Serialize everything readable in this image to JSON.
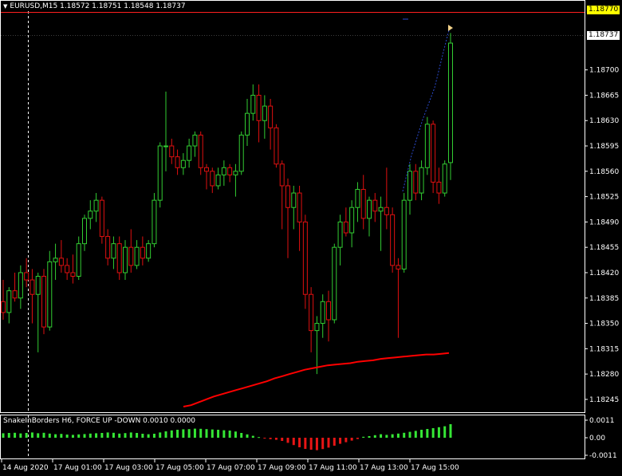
{
  "window": {
    "title": "EURUSD,M15  1.18572 1.18751 1.18548 1.18737"
  },
  "price_axis": {
    "labels": [
      "1.18737",
      "1.18700",
      "1.18665",
      "1.18630",
      "1.18595",
      "1.18560",
      "1.18525",
      "1.18490",
      "1.18455",
      "1.18420",
      "1.18385",
      "1.18350",
      "1.18315",
      "1.18280",
      "1.18245"
    ],
    "ask_label": "1.18770",
    "bid_label": "1.18737"
  },
  "subwindow": {
    "title": "SnakeInBorders H6, FORCE UP -DOWN  0.0010 0.0000",
    "labels": [
      "0.0011",
      "0.00",
      "-0.0011"
    ]
  },
  "time_axis": {
    "labels": [
      "14 Aug 2020",
      "17 Aug 01:00",
      "17 Aug 03:00",
      "17 Aug 05:00",
      "17 Aug 07:00",
      "17 Aug 09:00",
      "17 Aug 11:00",
      "17 Aug 13:00",
      "17 Aug 15:00"
    ]
  },
  "colors": {
    "background": "#000000",
    "bull": "#32cd32",
    "bear": "#e01010",
    "ma": "#ff0000",
    "grid": "#ffffff",
    "ask_tag": "#ffff00"
  },
  "chart_data": {
    "type": "candlestick",
    "symbol": "EURUSD",
    "timeframe": "M15",
    "ylim": [
      1.18235,
      1.1878
    ],
    "candles": [
      {
        "o": 1.1838,
        "h": 1.1841,
        "l": 1.18355,
        "c": 1.18365
      },
      {
        "o": 1.18365,
        "h": 1.184,
        "l": 1.1835,
        "c": 1.18395
      },
      {
        "o": 1.18395,
        "h": 1.1842,
        "l": 1.1838,
        "c": 1.18385
      },
      {
        "o": 1.18385,
        "h": 1.1843,
        "l": 1.1837,
        "c": 1.1842
      },
      {
        "o": 1.1842,
        "h": 1.1844,
        "l": 1.184,
        "c": 1.1841
      },
      {
        "o": 1.1841,
        "h": 1.18425,
        "l": 1.1835,
        "c": 1.1839
      },
      {
        "o": 1.1839,
        "h": 1.1842,
        "l": 1.1831,
        "c": 1.18415
      },
      {
        "o": 1.18415,
        "h": 1.18425,
        "l": 1.18335,
        "c": 1.18345
      },
      {
        "o": 1.18345,
        "h": 1.1845,
        "l": 1.1834,
        "c": 1.18435
      },
      {
        "o": 1.18435,
        "h": 1.1846,
        "l": 1.1841,
        "c": 1.1844
      },
      {
        "o": 1.1844,
        "h": 1.18465,
        "l": 1.1842,
        "c": 1.1843
      },
      {
        "o": 1.1843,
        "h": 1.1844,
        "l": 1.1841,
        "c": 1.1842
      },
      {
        "o": 1.1842,
        "h": 1.18445,
        "l": 1.18405,
        "c": 1.18415
      },
      {
        "o": 1.18415,
        "h": 1.1847,
        "l": 1.1841,
        "c": 1.1846
      },
      {
        "o": 1.1846,
        "h": 1.185,
        "l": 1.1845,
        "c": 1.18495
      },
      {
        "o": 1.18495,
        "h": 1.1852,
        "l": 1.1848,
        "c": 1.18505
      },
      {
        "o": 1.18505,
        "h": 1.1853,
        "l": 1.1849,
        "c": 1.1852
      },
      {
        "o": 1.1852,
        "h": 1.18525,
        "l": 1.1846,
        "c": 1.1847
      },
      {
        "o": 1.1847,
        "h": 1.1848,
        "l": 1.1843,
        "c": 1.1844
      },
      {
        "o": 1.1844,
        "h": 1.1847,
        "l": 1.18425,
        "c": 1.1846
      },
      {
        "o": 1.1846,
        "h": 1.1847,
        "l": 1.1841,
        "c": 1.1842
      },
      {
        "o": 1.1842,
        "h": 1.18465,
        "l": 1.1841,
        "c": 1.18455
      },
      {
        "o": 1.18455,
        "h": 1.1848,
        "l": 1.1842,
        "c": 1.1843
      },
      {
        "o": 1.1843,
        "h": 1.18465,
        "l": 1.18425,
        "c": 1.18455
      },
      {
        "o": 1.18455,
        "h": 1.1847,
        "l": 1.1843,
        "c": 1.1844
      },
      {
        "o": 1.1844,
        "h": 1.18465,
        "l": 1.18435,
        "c": 1.1846
      },
      {
        "o": 1.1846,
        "h": 1.1853,
        "l": 1.18455,
        "c": 1.1852
      },
      {
        "o": 1.1852,
        "h": 1.186,
        "l": 1.1851,
        "c": 1.18595
      },
      {
        "o": 1.18595,
        "h": 1.1867,
        "l": 1.1856,
        "c": 1.18595
      },
      {
        "o": 1.18595,
        "h": 1.18605,
        "l": 1.1857,
        "c": 1.1858
      },
      {
        "o": 1.1858,
        "h": 1.1859,
        "l": 1.18555,
        "c": 1.18565
      },
      {
        "o": 1.18565,
        "h": 1.18585,
        "l": 1.18555,
        "c": 1.18575
      },
      {
        "o": 1.18575,
        "h": 1.18605,
        "l": 1.18565,
        "c": 1.18595
      },
      {
        "o": 1.18595,
        "h": 1.18615,
        "l": 1.1858,
        "c": 1.1861
      },
      {
        "o": 1.1861,
        "h": 1.18615,
        "l": 1.18555,
        "c": 1.18565
      },
      {
        "o": 1.18565,
        "h": 1.1857,
        "l": 1.18535,
        "c": 1.1856
      },
      {
        "o": 1.1856,
        "h": 1.18565,
        "l": 1.1853,
        "c": 1.1854
      },
      {
        "o": 1.1854,
        "h": 1.18565,
        "l": 1.18535,
        "c": 1.18555
      },
      {
        "o": 1.18555,
        "h": 1.18575,
        "l": 1.1854,
        "c": 1.18565
      },
      {
        "o": 1.18565,
        "h": 1.1857,
        "l": 1.18545,
        "c": 1.18555
      },
      {
        "o": 1.18555,
        "h": 1.1857,
        "l": 1.18525,
        "c": 1.1856
      },
      {
        "o": 1.1856,
        "h": 1.18615,
        "l": 1.18555,
        "c": 1.1861
      },
      {
        "o": 1.1861,
        "h": 1.1866,
        "l": 1.18595,
        "c": 1.1864
      },
      {
        "o": 1.1864,
        "h": 1.1868,
        "l": 1.1863,
        "c": 1.18665
      },
      {
        "o": 1.18665,
        "h": 1.1868,
        "l": 1.186,
        "c": 1.1863
      },
      {
        "o": 1.1863,
        "h": 1.18665,
        "l": 1.18605,
        "c": 1.1865
      },
      {
        "o": 1.1865,
        "h": 1.1866,
        "l": 1.1859,
        "c": 1.1862
      },
      {
        "o": 1.1862,
        "h": 1.18625,
        "l": 1.18565,
        "c": 1.1857
      },
      {
        "o": 1.1857,
        "h": 1.18575,
        "l": 1.1848,
        "c": 1.1854
      },
      {
        "o": 1.1854,
        "h": 1.1855,
        "l": 1.1844,
        "c": 1.1851
      },
      {
        "o": 1.1851,
        "h": 1.1854,
        "l": 1.1848,
        "c": 1.1853
      },
      {
        "o": 1.1853,
        "h": 1.1854,
        "l": 1.1845,
        "c": 1.1849
      },
      {
        "o": 1.1849,
        "h": 1.185,
        "l": 1.1837,
        "c": 1.1839
      },
      {
        "o": 1.1839,
        "h": 1.184,
        "l": 1.1831,
        "c": 1.1834
      },
      {
        "o": 1.1834,
        "h": 1.1836,
        "l": 1.1828,
        "c": 1.1835
      },
      {
        "o": 1.1835,
        "h": 1.1839,
        "l": 1.1833,
        "c": 1.1838
      },
      {
        "o": 1.1838,
        "h": 1.18395,
        "l": 1.18325,
        "c": 1.18355
      },
      {
        "o": 1.18355,
        "h": 1.1846,
        "l": 1.1835,
        "c": 1.18455
      },
      {
        "o": 1.18455,
        "h": 1.185,
        "l": 1.1843,
        "c": 1.1849
      },
      {
        "o": 1.1849,
        "h": 1.1851,
        "l": 1.1847,
        "c": 1.18475
      },
      {
        "o": 1.18475,
        "h": 1.1852,
        "l": 1.18455,
        "c": 1.1851
      },
      {
        "o": 1.1851,
        "h": 1.18545,
        "l": 1.1849,
        "c": 1.18535
      },
      {
        "o": 1.18535,
        "h": 1.18555,
        "l": 1.1848,
        "c": 1.18495
      },
      {
        "o": 1.18495,
        "h": 1.18525,
        "l": 1.1847,
        "c": 1.1852
      },
      {
        "o": 1.1852,
        "h": 1.1853,
        "l": 1.1849,
        "c": 1.18505
      },
      {
        "o": 1.18505,
        "h": 1.18525,
        "l": 1.1845,
        "c": 1.1851
      },
      {
        "o": 1.1851,
        "h": 1.18565,
        "l": 1.1848,
        "c": 1.185
      },
      {
        "o": 1.185,
        "h": 1.1851,
        "l": 1.1842,
        "c": 1.1843
      },
      {
        "o": 1.1843,
        "h": 1.1844,
        "l": 1.1833,
        "c": 1.18425
      },
      {
        "o": 1.18425,
        "h": 1.1853,
        "l": 1.1842,
        "c": 1.1852
      },
      {
        "o": 1.1852,
        "h": 1.1857,
        "l": 1.185,
        "c": 1.1856
      },
      {
        "o": 1.1856,
        "h": 1.1857,
        "l": 1.1852,
        "c": 1.1853
      },
      {
        "o": 1.1853,
        "h": 1.18575,
        "l": 1.1852,
        "c": 1.18565
      },
      {
        "o": 1.18565,
        "h": 1.18635,
        "l": 1.18555,
        "c": 1.18625
      },
      {
        "o": 1.18625,
        "h": 1.1863,
        "l": 1.1853,
        "c": 1.18545
      },
      {
        "o": 1.18545,
        "h": 1.18565,
        "l": 1.18515,
        "c": 1.1853
      },
      {
        "o": 1.1853,
        "h": 1.18575,
        "l": 1.18525,
        "c": 1.1857
      },
      {
        "o": 1.18572,
        "h": 1.18751,
        "l": 1.18548,
        "c": 1.18737
      }
    ],
    "ma_series": [
      1.18235,
      1.18237,
      1.18241,
      1.18245,
      1.18249,
      1.18252,
      1.18255,
      1.18258,
      1.18261,
      1.18264,
      1.18267,
      1.1827,
      1.18274,
      1.18277,
      1.1828,
      1.18283,
      1.18286,
      1.18288,
      1.1829,
      1.18292,
      1.18293,
      1.18294,
      1.18295,
      1.18297,
      1.18298,
      1.18299,
      1.18301,
      1.18302,
      1.18303,
      1.18304,
      1.18305,
      1.18306,
      1.18307,
      1.18307,
      1.18308,
      1.18309
    ],
    "histogram": [
      0.00028,
      0.0003,
      0.00031,
      0.00027,
      0.0003,
      0.00033,
      0.00028,
      0.00031,
      0.00026,
      0.00022,
      0.00024,
      0.0002,
      0.00018,
      0.00021,
      0.00023,
      0.00026,
      0.00028,
      0.0003,
      0.00033,
      0.00031,
      0.00026,
      0.00029,
      0.00033,
      0.0003,
      0.00025,
      0.00022,
      0.00025,
      0.00033,
      0.0004,
      0.00046,
      0.0005,
      0.00053,
      0.00054,
      0.00057,
      0.00056,
      0.00054,
      0.00052,
      0.0005,
      0.00047,
      0.00045,
      0.00039,
      0.0003,
      0.00021,
      0.00012,
      4e-05,
      -3e-05,
      -9e-05,
      -0.00013,
      -0.0002,
      -0.00032,
      -0.00046,
      -0.0006,
      -0.0007,
      -0.00075,
      -0.00078,
      -0.00071,
      -0.00062,
      -0.0005,
      -0.00038,
      -0.00028,
      -0.00018,
      -8e-05,
      6e-05,
      0.0001,
      0.00016,
      0.00022,
      0.00018,
      0.00022,
      0.00026,
      0.00031,
      0.00037,
      0.00043,
      0.0005,
      0.00055,
      0.0006,
      0.00066,
      0.00072,
      0.00085
    ],
    "histogram_ylim": [
      -0.0011,
      0.0011
    ]
  }
}
